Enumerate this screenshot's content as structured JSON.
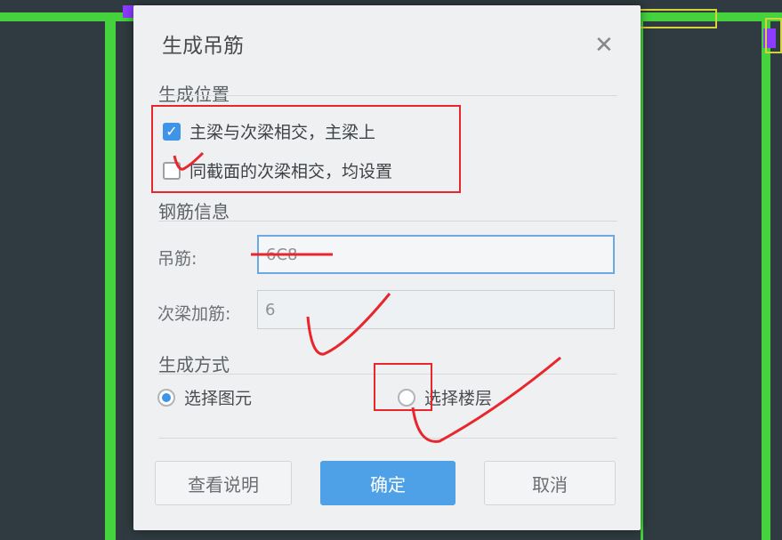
{
  "dialog": {
    "title": "生成吊筋",
    "close_glyph": "✕"
  },
  "position_section": {
    "heading": "生成位置",
    "options": [
      {
        "label": "主梁与次梁相交，主梁上",
        "checked": true
      },
      {
        "label": "同截面的次梁相交，均设置",
        "checked": false
      }
    ]
  },
  "rebar_section": {
    "heading": "钢筋信息",
    "hanger_label": "吊筋:",
    "hanger_value": "6C8",
    "extra_label": "次梁加筋:",
    "extra_value": "6"
  },
  "mode_section": {
    "heading": "生成方式",
    "options": [
      {
        "label": "选择图元",
        "selected": true
      },
      {
        "label": "选择楼层",
        "selected": false
      }
    ]
  },
  "buttons": {
    "help": "查看说明",
    "ok": "确定",
    "cancel": "取消"
  },
  "colors": {
    "accent": "#3f94e8",
    "annotation": "#e8262b",
    "cad_green": "#44d33c"
  },
  "icons": {
    "close": "close-icon",
    "check": "checkmark-icon"
  }
}
